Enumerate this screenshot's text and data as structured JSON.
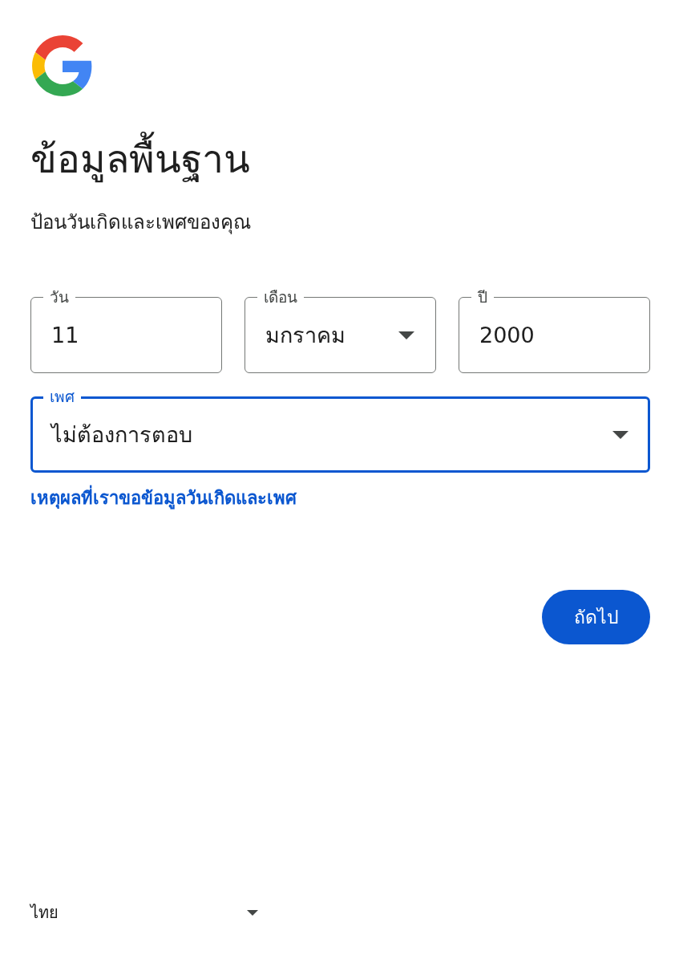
{
  "header": {
    "title": "ข้อมูลพื้นฐาน",
    "subtitle": "ป้อนวันเกิดและเพศของคุณ"
  },
  "date_fields": [
    {
      "label": "วัน",
      "value": "11",
      "kind": "text",
      "focused": false
    },
    {
      "label": "เดือน",
      "value": "มกราคม",
      "kind": "select",
      "focused": false
    },
    {
      "label": "ปี",
      "value": "2000",
      "kind": "text",
      "focused": false
    }
  ],
  "gender_field": {
    "label": "เพศ",
    "value": "ไม่ต้องการตอบ",
    "kind": "select",
    "focused": true
  },
  "info_link": "เหตุผลที่เราขอข้อมูลวันเกิดและเพศ",
  "next_button": "ถัดไป",
  "footer": {
    "language": "ไทย"
  }
}
